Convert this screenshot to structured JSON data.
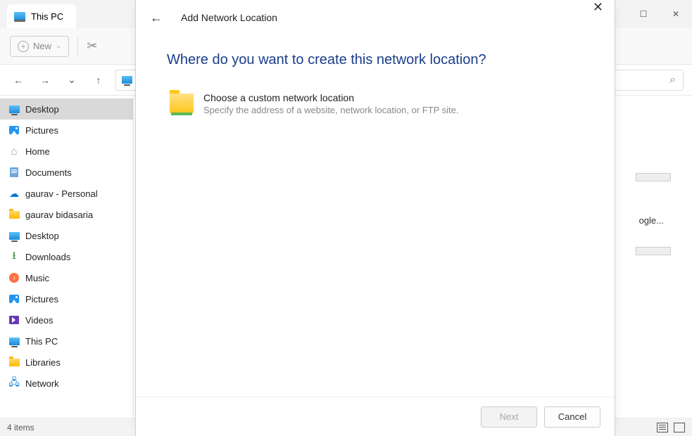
{
  "window": {
    "tab_title": "This PC"
  },
  "toolbar": {
    "new_label": "New",
    "cut_icon": "scissors-icon"
  },
  "sidebar": {
    "items": [
      {
        "label": "Desktop",
        "icon": "monitor",
        "selected": true
      },
      {
        "label": "Pictures",
        "icon": "picture"
      },
      {
        "label": "Home",
        "icon": "home"
      },
      {
        "label": "Documents",
        "icon": "document"
      },
      {
        "label": "gaurav - Personal",
        "icon": "onedrive"
      },
      {
        "label": "gaurav bidasaria",
        "icon": "folder"
      },
      {
        "label": "Desktop",
        "icon": "monitor"
      },
      {
        "label": "Downloads",
        "icon": "download"
      },
      {
        "label": "Music",
        "icon": "music"
      },
      {
        "label": "Pictures",
        "icon": "picture"
      },
      {
        "label": "Videos",
        "icon": "video"
      },
      {
        "label": "This PC",
        "icon": "monitor"
      },
      {
        "label": "Libraries",
        "icon": "folder"
      },
      {
        "label": "Network",
        "icon": "network"
      }
    ]
  },
  "content": {
    "truncated_text": "ogle..."
  },
  "statusbar": {
    "item_count": "4 items"
  },
  "dialog": {
    "title": "Add Network Location",
    "heading": "Where do you want to create this network location?",
    "option": {
      "title": "Choose a custom network location",
      "subtitle": "Specify the address of a website, network location, or FTP site."
    },
    "buttons": {
      "next": "Next",
      "cancel": "Cancel"
    }
  }
}
